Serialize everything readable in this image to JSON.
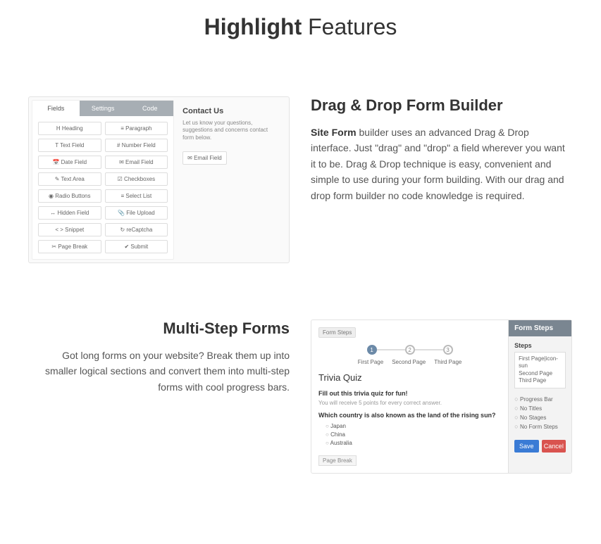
{
  "title": {
    "bold": "Highlight",
    "rest": " Features"
  },
  "feature1": {
    "heading": "Drag & Drop Form Builder",
    "desc_strong": "Site Form",
    "desc_rest": " builder uses an advanced Drag & Drop interface. Just \"drag\" and \"drop\" a field wherever you want it to be. Drag & Drop technique is easy, convenient and simple to use during your form building. With our drag and drop form builder no code knowledge is required.",
    "mock": {
      "tabs": [
        "Fields",
        "Settings",
        "Code"
      ],
      "fields": [
        "H Heading",
        "≡ Paragraph",
        "T Text Field",
        "# Number Field",
        "📅 Date Field",
        "✉ Email Field",
        "✎ Text Area",
        "☑ Checkboxes",
        "◉ Radio Buttons",
        "≡ Select List",
        "↔ Hidden Field",
        "📎 File Upload",
        "< > Snippet",
        "↻ reCaptcha",
        "✂ Page Break",
        "✔ Submit"
      ],
      "main_title": "Contact Us",
      "main_desc": "Let us know your questions, suggestions and concerns contact form below.",
      "dropped": "✉ Email Field"
    }
  },
  "feature2": {
    "heading": "Multi-Step Forms",
    "desc": "Got long forms on your website? Break them up into smaller logical sections and convert them into multi-step forms with cool progress bars.",
    "mock": {
      "badge": "Form Steps",
      "step_labels": [
        "First Page",
        "Second Page",
        "Third Page"
      ],
      "quiz_title": "Trivia Quiz",
      "quiz_sub": "Fill out this trivia quiz for fun!",
      "quiz_note": "You will receive 5 points for every correct answer.",
      "question": "Which country is also known as the land of the rising sun?",
      "options": [
        "Japan",
        "China",
        "Australia"
      ],
      "page_break": "Page Break",
      "side_heading": "Form Steps",
      "side_steps_label": "Steps",
      "side_steps_text": "First Page|icon-sun\nSecond Page\nThird Page",
      "side_checks": [
        "Progress Bar",
        "No Titles",
        "No Stages",
        "No Form Steps"
      ],
      "btn_save": "Save",
      "btn_cancel": "Cancel"
    }
  }
}
